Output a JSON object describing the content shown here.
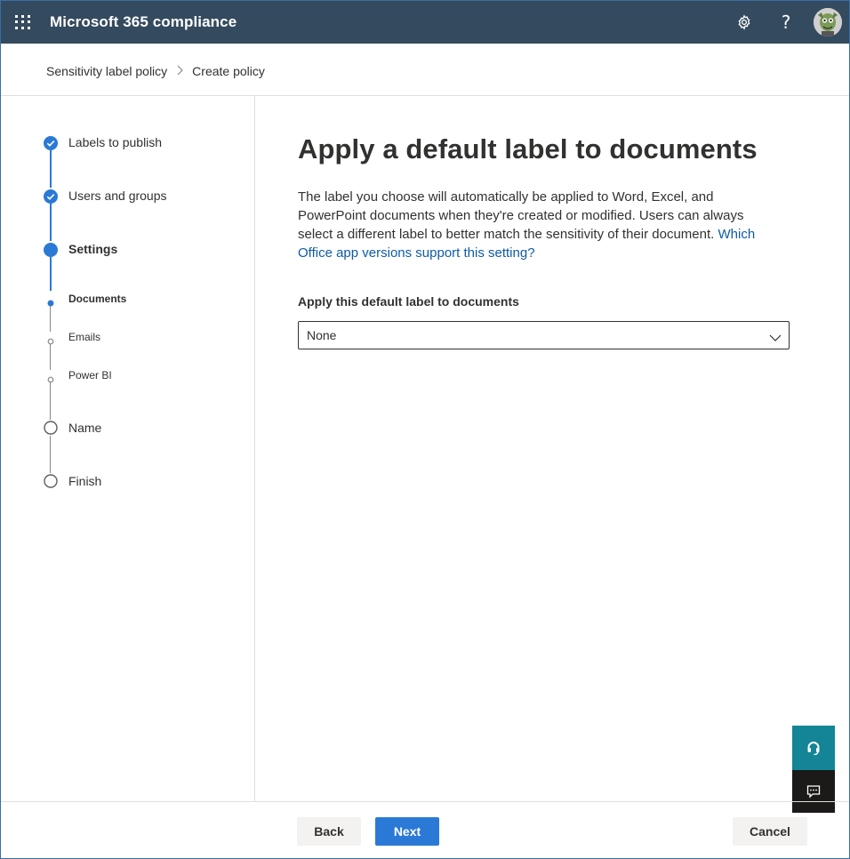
{
  "app": {
    "title": "Microsoft 365 compliance"
  },
  "header": {
    "icons": [
      "waffle-icon",
      "gear-icon",
      "help-icon",
      "avatar"
    ],
    "help_glyph": "?"
  },
  "breadcrumb": {
    "items": [
      "Sensitivity label policy",
      "Create policy"
    ],
    "separator": ">"
  },
  "wizard": {
    "steps": [
      {
        "label": "Labels to publish",
        "state": "completed"
      },
      {
        "label": "Users and groups",
        "state": "completed"
      },
      {
        "label": "Settings",
        "state": "current"
      },
      {
        "label": "Name",
        "state": "pending"
      },
      {
        "label": "Finish",
        "state": "pending"
      }
    ],
    "substeps": [
      {
        "label": "Documents",
        "state": "current"
      },
      {
        "label": "Emails",
        "state": "pending"
      },
      {
        "label": "Power BI",
        "state": "pending"
      }
    ]
  },
  "main": {
    "title": "Apply a default label to documents",
    "description": "The label you choose will automatically be applied to Word, Excel, and PowerPoint documents when they're created or modified. Users can always select a different label to better match the sensitivity of their document.",
    "link": "Which Office app versions support this setting?",
    "field_label": "Apply this default label to documents",
    "dropdown_value": "None"
  },
  "footer": {
    "back_label": "Back",
    "next_label": "Next",
    "cancel_label": "Cancel"
  },
  "colors": {
    "topbar": "#344a5e",
    "accent": "#2b79d6",
    "link": "#0f5ba7",
    "help_float": "#138596",
    "chat_float": "#1b1a19"
  }
}
